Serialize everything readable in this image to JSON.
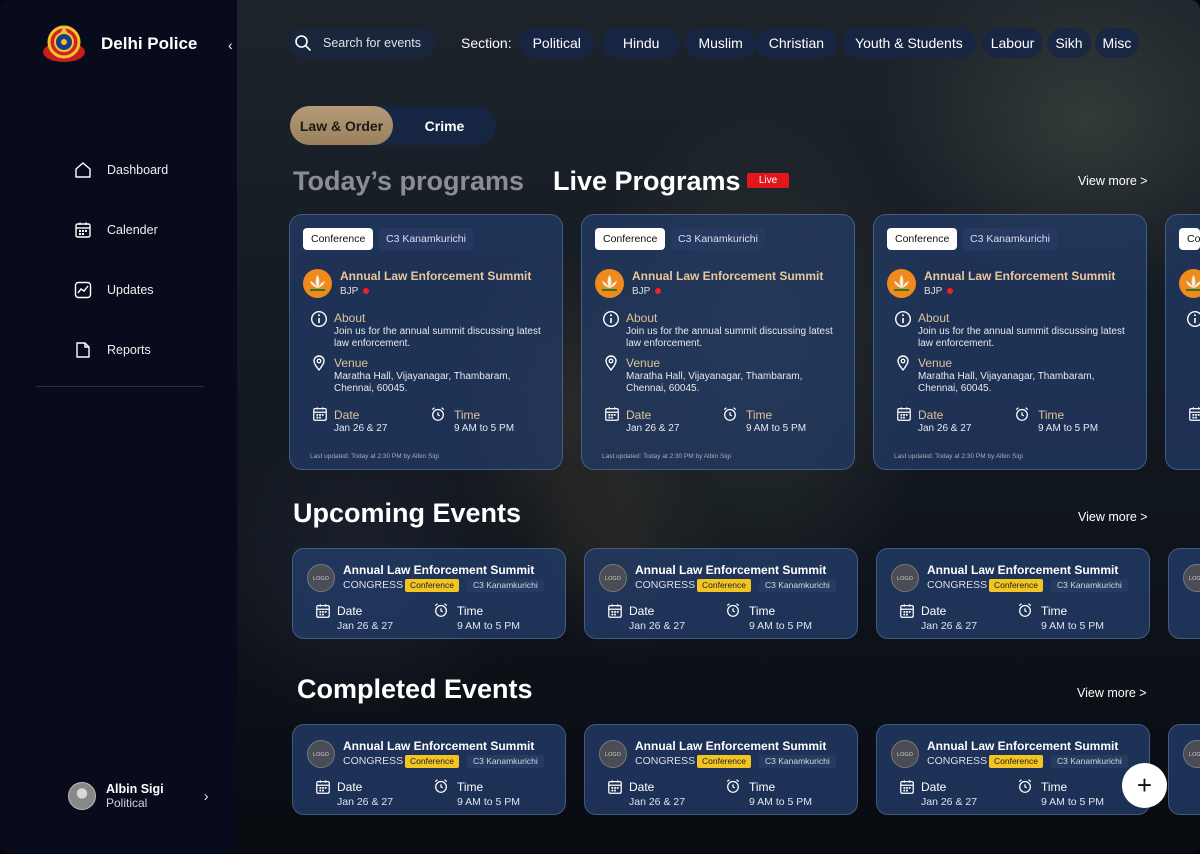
{
  "app": {
    "title": "Delhi Police"
  },
  "sidebar": {
    "items": [
      {
        "label": "Dashboard",
        "icon": "home-icon"
      },
      {
        "label": "Calender",
        "icon": "calendar-icon"
      },
      {
        "label": "Updates",
        "icon": "chart-icon"
      },
      {
        "label": "Reports",
        "icon": "report-icon"
      }
    ]
  },
  "user": {
    "name": "Albin Sigi",
    "role": "Political"
  },
  "search": {
    "placeholder": "Search for events"
  },
  "sections": {
    "label": "Section:",
    "items": [
      "Political",
      "Hindu",
      "Muslim",
      "Christian",
      "Youth & Students",
      "Labour",
      "Sikh",
      "Misc"
    ]
  },
  "toggle": {
    "options": [
      "Law & Order",
      "Crime"
    ],
    "selected": "Law & Order"
  },
  "headings": {
    "today": "Today’s programs",
    "live": "Live Programs",
    "live_badge": "Live",
    "upcoming": "Upcoming Events",
    "completed": "Completed Events",
    "view_more": "View more >"
  },
  "live_cards": [
    {
      "type": "Conference",
      "place": "C3 Kanamkurichi",
      "title": "Annual Law Enforcement Summit",
      "party": "BJP",
      "about_label": "About",
      "about": "Join us for the annual summit discussing latest law enforcement.",
      "venue_label": "Venue",
      "venue": "Maratha Hall, Vijayanagar, Thambaram, Chennai, 60045.",
      "date_label": "Date",
      "date": "Jan 26 & 27",
      "time_label": "Time",
      "time": "9 AM to 5 PM",
      "updated": "Last updated: Today at 2:30 PM by Albin Sigi"
    },
    {
      "type": "Conference",
      "place": "C3 Kanamkurichi",
      "title": "Annual Law Enforcement Summit",
      "party": "BJP",
      "about_label": "About",
      "about": "Join us for the annual summit discussing latest law enforcement.",
      "venue_label": "Venue",
      "venue": "Maratha Hall, Vijayanagar, Thambaram, Chennai, 60045.",
      "date_label": "Date",
      "date": "Jan 26 & 27",
      "time_label": "Time",
      "time": "9 AM to 5 PM",
      "updated": "Last updated: Today at 2:30 PM by Albin Sigi"
    },
    {
      "type": "Conference",
      "place": "C3 Kanamkurichi",
      "title": "Annual Law Enforcement Summit",
      "party": "BJP",
      "about_label": "About",
      "about": "Join us for the annual summit discussing latest law enforcement.",
      "venue_label": "Venue",
      "venue": "Maratha Hall, Vijayanagar, Thambaram, Chennai, 60045.",
      "date_label": "Date",
      "date": "Jan 26 & 27",
      "time_label": "Time",
      "time": "9 AM to 5 PM",
      "updated": "Last updated: Today at 2:30 PM by Albin Sigi"
    },
    {
      "type": "Co"
    }
  ],
  "upcoming_cards": [
    {
      "logo": "LOGO",
      "title": "Annual Law Enforcement Summit",
      "party": "CONGRESS",
      "type": "Conference",
      "place": "C3 Kanamkurichi",
      "date_label": "Date",
      "date": "Jan 26 & 27",
      "time_label": "Time",
      "time": "9 AM to 5 PM"
    },
    {
      "logo": "LOGO",
      "title": "Annual Law Enforcement Summit",
      "party": "CONGRESS",
      "type": "Conference",
      "place": "C3 Kanamkurichi",
      "date_label": "Date",
      "date": "Jan 26 & 27",
      "time_label": "Time",
      "time": "9 AM to 5 PM"
    },
    {
      "logo": "LOGO",
      "title": "Annual Law Enforcement Summit",
      "party": "CONGRESS",
      "type": "Conference",
      "place": "C3 Kanamkurichi",
      "date_label": "Date",
      "date": "Jan 26 & 27",
      "time_label": "Time",
      "time": "9 AM to 5 PM"
    }
  ],
  "completed_cards": [
    {
      "logo": "LOGO",
      "title": "Annual Law Enforcement Summit",
      "party": "CONGRESS",
      "type": "Conference",
      "place": "C3 Kanamkurichi",
      "date_label": "Date",
      "date": "Jan 26 & 27",
      "time_label": "Time",
      "time": "9 AM to 5 PM"
    },
    {
      "logo": "LOGO",
      "title": "Annual Law Enforcement Summit",
      "party": "CONGRESS",
      "type": "Conference",
      "place": "C3 Kanamkurichi",
      "date_label": "Date",
      "date": "Jan 26 & 27",
      "time_label": "Time",
      "time": "9 AM to 5 PM"
    },
    {
      "logo": "LOGO",
      "title": "Annual Law Enforcement Summit",
      "party": "CONGRESS",
      "type": "Conference",
      "place": "C3 Kanamkurichi",
      "date_label": "Date",
      "date": "Jan 26 & 27",
      "time_label": "Time",
      "time": "9 AM to 5 PM"
    }
  ],
  "fab": {
    "label": "+"
  },
  "colors": {
    "sidebar": "#070b1c",
    "accent_gold": "#b49a77",
    "live_red": "#e2171b",
    "tag_yellow": "#f2c523",
    "card_blue": "#233c69"
  }
}
